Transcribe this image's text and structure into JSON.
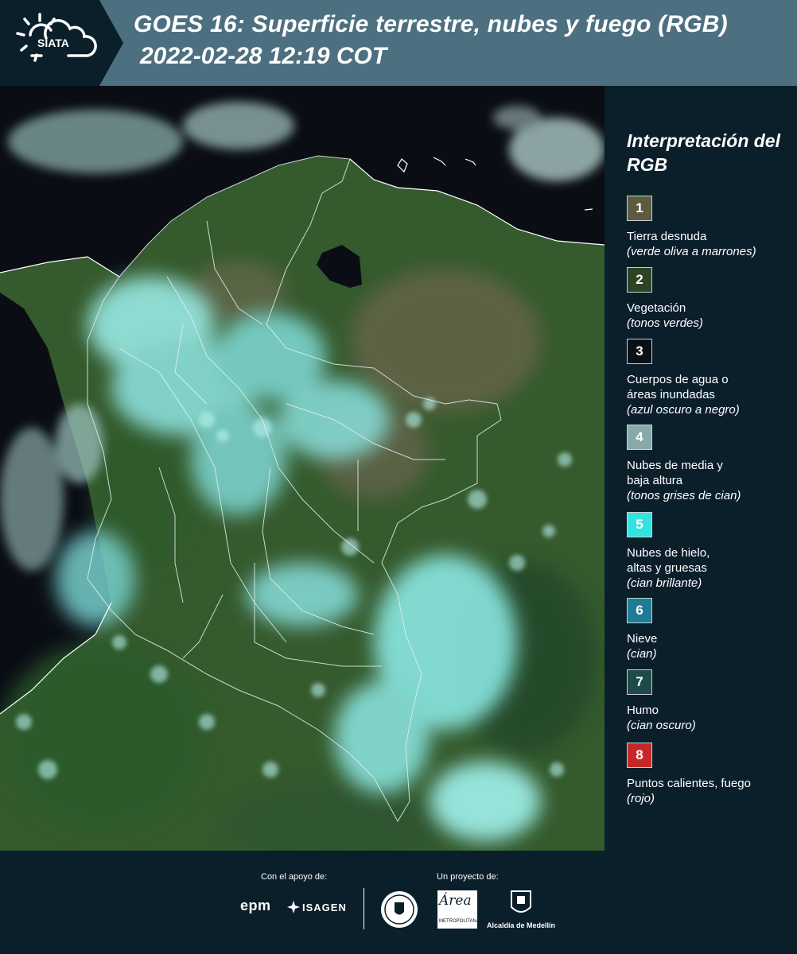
{
  "header": {
    "logo_text": "SIATA",
    "title_line1": "GOES 16: Superficie terrestre, nubes y fuego (RGB)",
    "title_line2": " 2022-02-28 12:19 COT"
  },
  "legend": {
    "title": "Interpretación del RGB",
    "items": [
      {
        "num": "1",
        "label": "Tierra desnuda",
        "sub": "(verde oliva a marrones)",
        "color": "#5d5b3f"
      },
      {
        "num": "2",
        "label": "Vegetación",
        "sub": "(tonos verdes)",
        "color": "#2c4324"
      },
      {
        "num": "3",
        "label": "Cuerpos de agua o\náreas inundadas",
        "sub": "(azul oscuro a negro)",
        "color": "#0b1015"
      },
      {
        "num": "4",
        "label": "Nubes de media y\nbaja altura",
        "sub": "(tonos grises de cian)",
        "color": "#88aaa8"
      },
      {
        "num": "5",
        "label": "Nubes de hielo,\naltas y gruesas",
        "sub": "(cian brillante)",
        "color": "#33e3e0"
      },
      {
        "num": "6",
        "label": "Nieve",
        "sub": "(cian)",
        "color": "#1e7d95"
      },
      {
        "num": "7",
        "label": "Humo",
        "sub": "(cian oscuro)",
        "color": "#1f4a4a"
      },
      {
        "num": "8",
        "label": "Puntos calientes, fuego",
        "sub": "(rojo)",
        "color": "#c62828"
      }
    ]
  },
  "footer": {
    "support_label": "Con el apoyo de:",
    "project_label": "Un proyecto de:",
    "epm": "epm",
    "isagen": "ISAGEN",
    "area_text": "Área",
    "area_sub": "METROPOLITANA Valle de Aburrá",
    "alcaldia": "Alcaldía de Medellín"
  },
  "colors": {
    "header_bg": "#4d7080",
    "panel_bg": "#0b1f2b",
    "ocean": "#0a0e14",
    "vegetation": "#3a5a30",
    "cloud_ice": "#7fe8e4"
  }
}
